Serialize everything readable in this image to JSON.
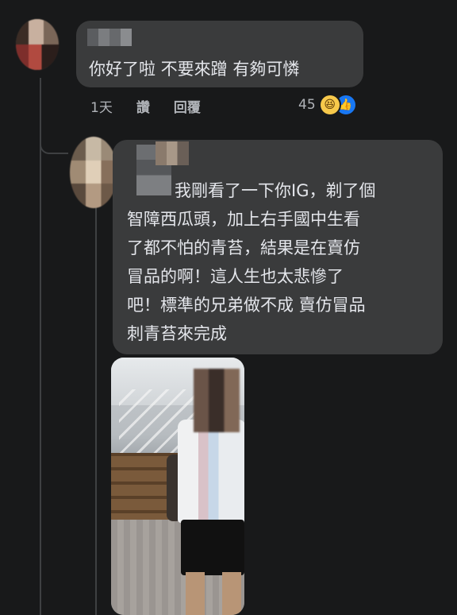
{
  "comments": [
    {
      "text": "你好了啦 不要來蹭 有夠可憐",
      "time": "1天",
      "like_label": "讚",
      "reply_label": "回覆",
      "reaction_count": "45",
      "reactions": [
        "haha-icon",
        "like-icon"
      ]
    },
    {
      "text_line_1": "我剛看了一下你IG，剃了個",
      "text_rest": "智障西瓜頭，加上右手國中生看\n了都不怕的青苔，結果是在賣仿\n冒品的啊！這人生也太悲慘了\n吧！標準的兄弟做不成 賣仿冒品\n刺青苔來完成"
    }
  ],
  "colors": {
    "background": "#18191a",
    "bubble": "#3a3b3c",
    "text": "#e4e6eb",
    "secondary_text": "#b0b3b8",
    "like_blue": "#1877f2",
    "haha_yellow": "#f7c94b"
  }
}
